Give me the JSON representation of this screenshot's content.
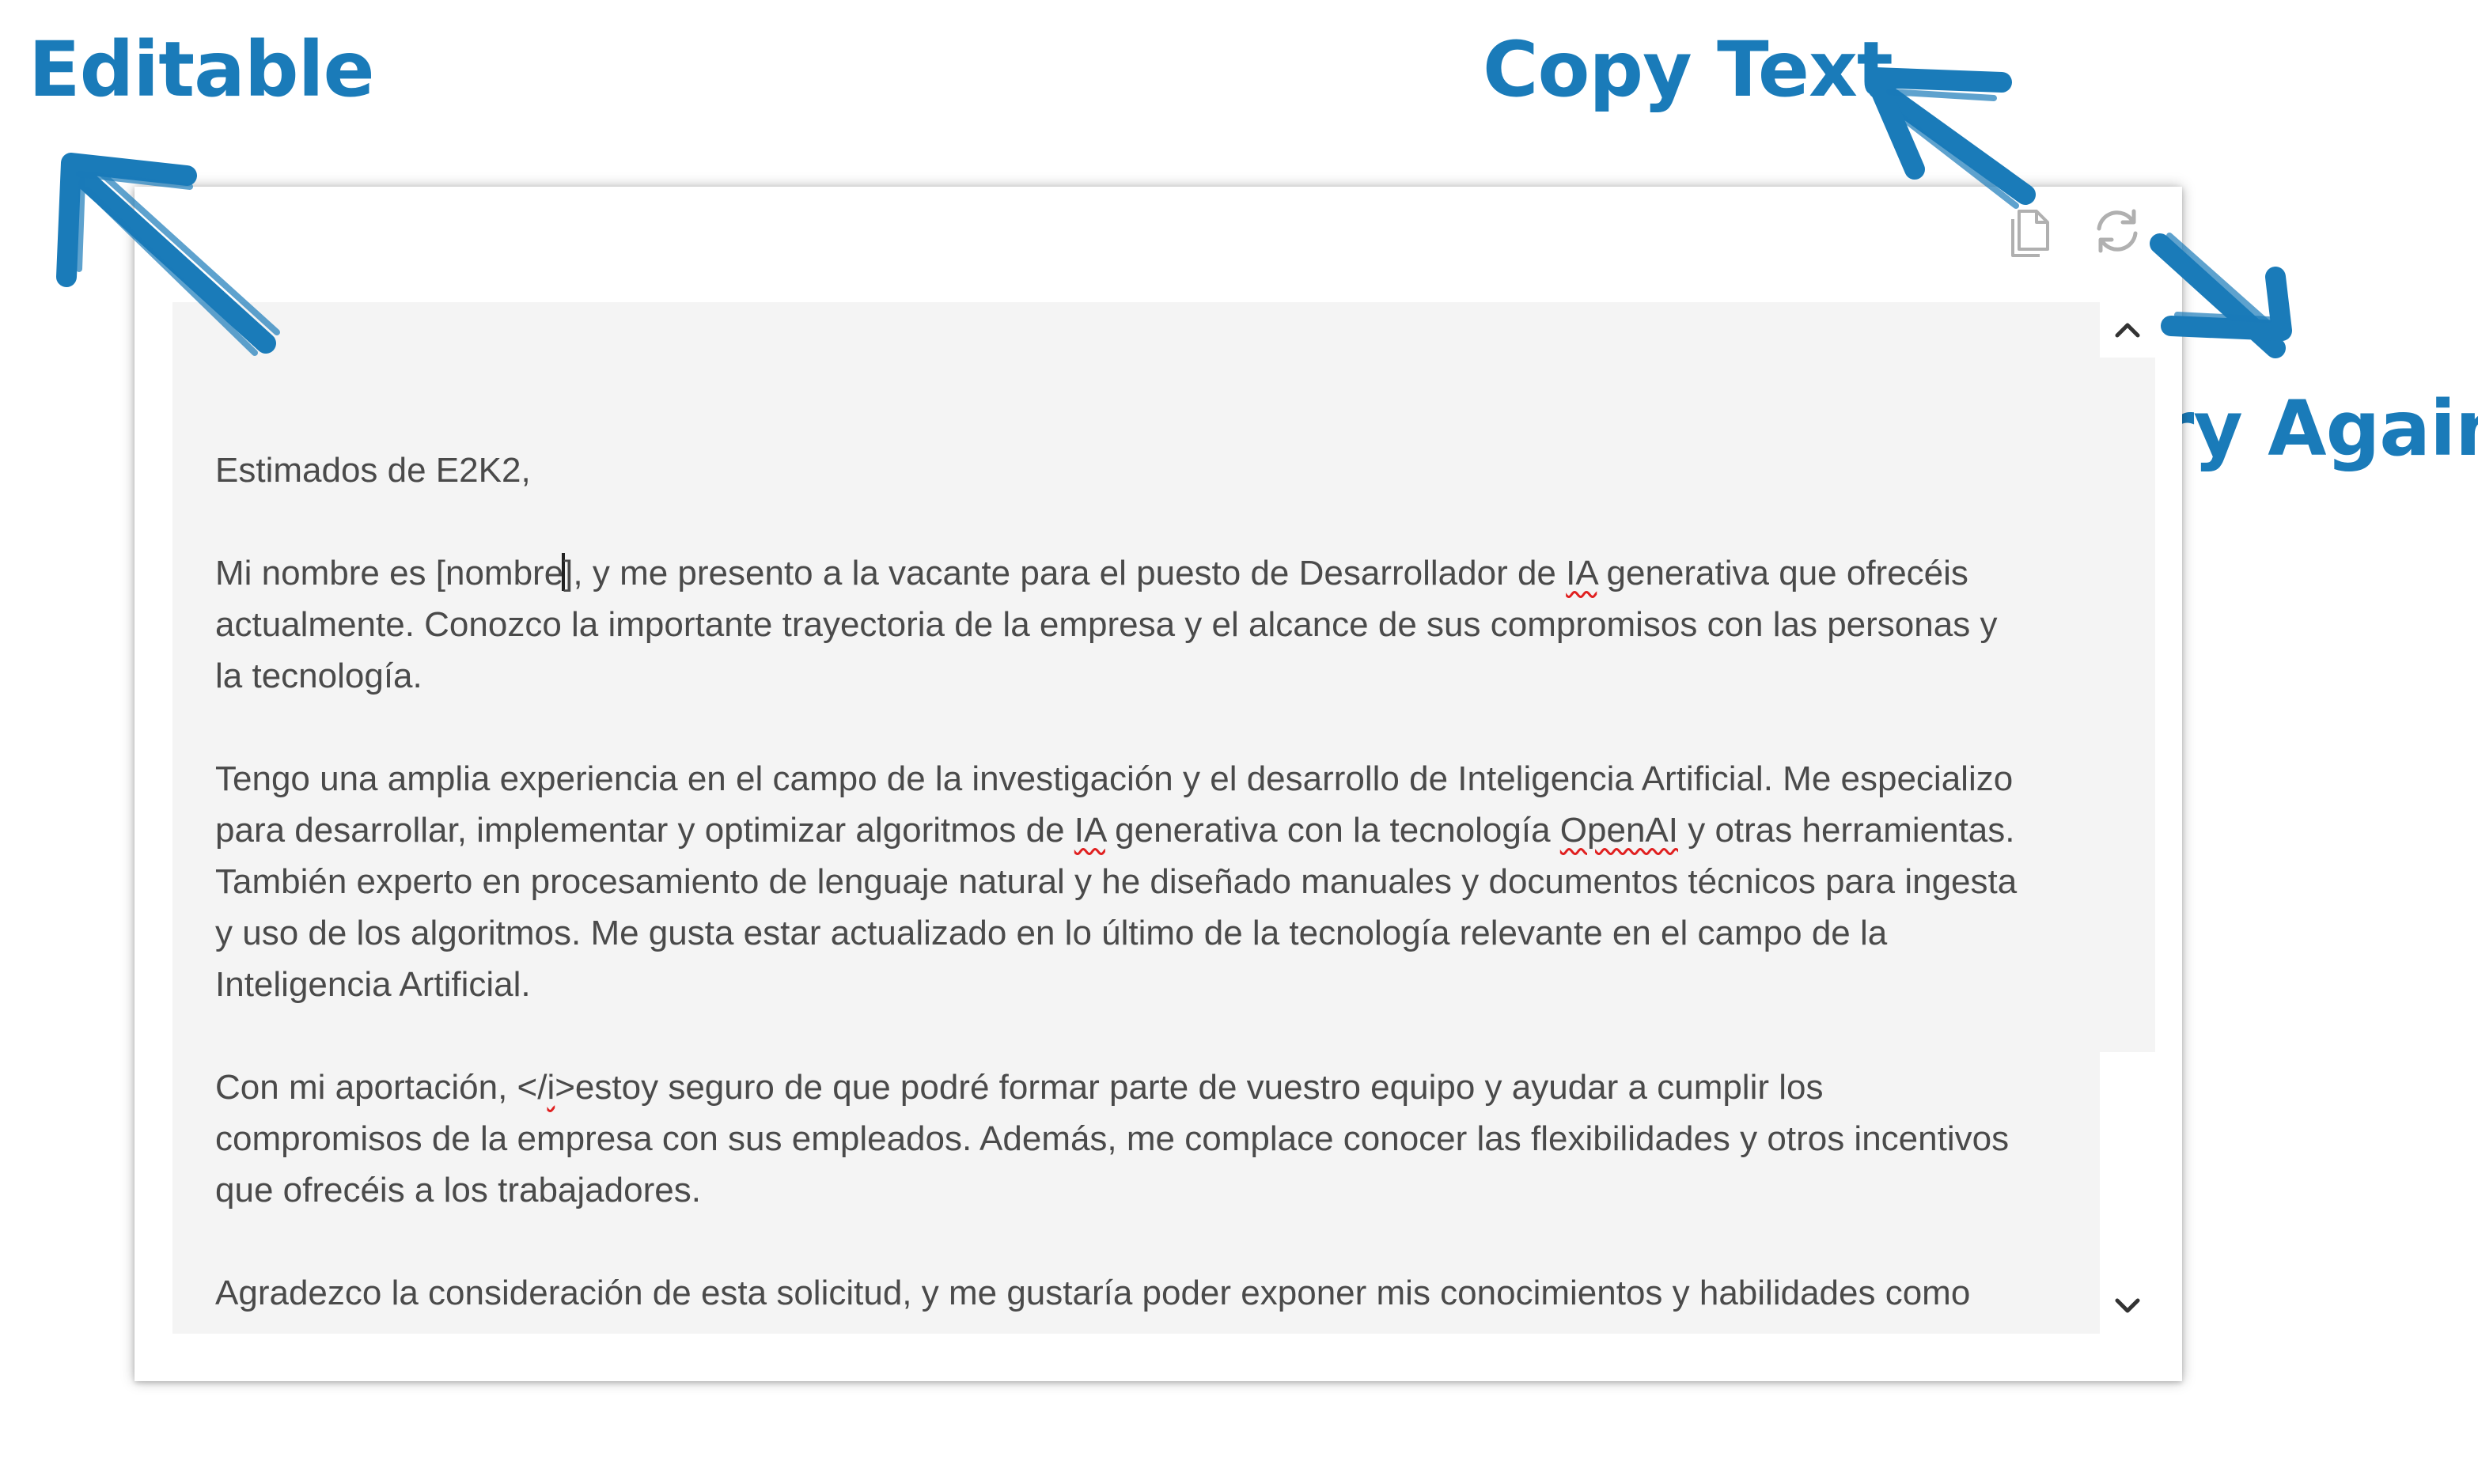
{
  "annotations": {
    "editable": "Editable",
    "copy_text": "Copy Text",
    "try_again": "Try Again"
  },
  "toolbar": {
    "copy_icon": "copy-icon",
    "retry_icon": "refresh-icon"
  },
  "letter": {
    "greeting": "Estimados de E2K2,",
    "p1_before_caret": "Mi nombre es [nombre",
    "p1_after_caret": "], y me presento a la vacante para el puesto de Desarrollador de ",
    "p1_ia": "IA",
    "p1_rest": " generativa que ofrecéis actualmente. Conozco la importante trayectoria de la empresa y el alcance de sus compromisos con las personas y la tecnología.",
    "p2_start": "Tengo una amplia experiencia en el campo de la investigación y el desarrollo de Inteligencia Artificial. Me especializo para desarrollar, implementar y optimizar algoritmos de ",
    "p2_ia": "IA",
    "p2_mid": " generativa con la tecnología ",
    "p2_openai": "OpenAI",
    "p2_rest": " y otras herramientas. También experto en procesamiento de lenguaje natural y he diseñado manuales y documentos técnicos para ingesta y uso de los algoritmos. Me gusta estar actualizado en lo último de la tecnología relevante en el campo de la Inteligencia Artificial.",
    "p3_start": "Con mi aportación, </",
    "p3_i": "i",
    "p3_rest": ">estoy seguro de que podré formar parte de vuestro equipo y ayudar a cumplir los compromisos de la empresa con sus empleados. Además, me complace conocer las flexibilidades y otros incentivos que ofrecéis a los trabajadores.",
    "p4": "Agradezco la consideración de esta solicitud, y me gustaría poder exponer mis conocimientos y habilidades como"
  },
  "colors": {
    "annotation_blue": "#1a7bb9",
    "editor_bg": "#f4f4f4",
    "text": "#4a4a4a",
    "spell_underline": "#e02020",
    "icon_gray": "#b0b0b0"
  }
}
